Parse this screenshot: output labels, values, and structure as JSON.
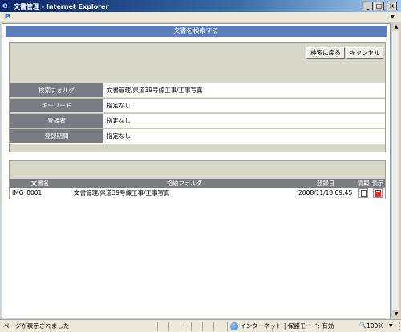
{
  "window": {
    "title": "文書管理 - Internet Explorer"
  },
  "header": {
    "title": "文書を検索する"
  },
  "search": {
    "back_label": "検索に戻る",
    "cancel_label": "キャンセル",
    "criteria": [
      {
        "label": "検索フォルダ",
        "value": "文書管理/県道39号線工事/工事写真"
      },
      {
        "label": "キーワード",
        "value": "指定なし"
      },
      {
        "label": "登録者",
        "value": "指定なし"
      },
      {
        "label": "登録期間",
        "value": "指定なし"
      }
    ]
  },
  "results": {
    "columns": [
      "文書名",
      "格納フォルダ",
      "登録日",
      "情報",
      "表示"
    ],
    "rows": [
      {
        "name": "IMG_0001",
        "folder": "文書管理/県道39号線工事/工事写真",
        "date": "2008/11/13 09:45"
      }
    ]
  },
  "statusbar": {
    "text": "ページが表示されました",
    "zone": "インターネット | 保護モード: 有効",
    "zoom": "100%"
  },
  "colors": {
    "accent": "#5b7fbd",
    "label_bg": "#7b7b84",
    "panel_bg": "#d8d8c8"
  }
}
